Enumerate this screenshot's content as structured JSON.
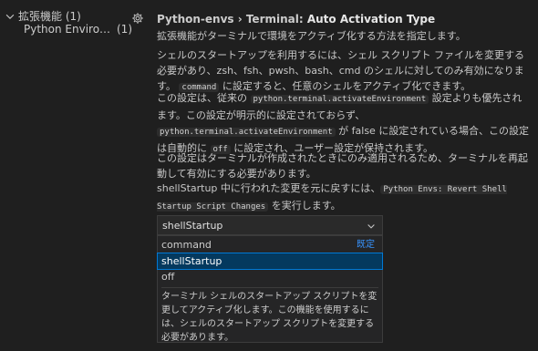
{
  "sidebar": {
    "group_label": "拡張機能 (1)",
    "item_label": "Python Environme...",
    "item_count": "(1)"
  },
  "setting": {
    "category": "Python-envs › Terminal: ",
    "name": "Auto Activation Type",
    "desc1": "拡張機能がターミナルで環境をアクティブ化する方法を指定します。",
    "desc2_a": "シェルのスタートアップを利用するには、シェル スクリプト ファイルを変更する必要があり、zsh、fsh、pwsh、bash、cmd のシェルに対してのみ有効になります。",
    "desc2_code": "command",
    "desc2_b": " に設定すると、任意のシェルをアクティブ化できます。",
    "desc3_a": "この設定は、従来の ",
    "desc3_code1": "python.terminal.activateEnvironment",
    "desc3_b": " 設定よりも優先されます。この設定が明示的に設定されておらず、",
    "desc3_code2": "python.terminal.activateEnvironment",
    "desc3_c": " が false に設定されている場合、この設定は自動的に ",
    "desc3_code3": "off",
    "desc3_d": " に設定され、ユーザー設定が保持されます。",
    "desc4": "この設定はターミナルが作成されたときにのみ適用されるため、ターミナルを再起動して有効にする必要があります。",
    "desc5_a": "shellStartup 中に行われた変更を元に戻すには、",
    "desc5_code": "Python Envs: Revert Shell Startup Script Changes",
    "desc5_b": " を実行します。",
    "select_value": "shellStartup",
    "options": [
      {
        "label": "command",
        "default_badge": "既定"
      },
      {
        "label": "shellStartup"
      },
      {
        "label": "off"
      }
    ],
    "option_description": "ターミナル シェルのスタートアップ スクリプトを変更してアクティブ化します。この機能を使用するには、シェルのスタートアップ スクリプトを変更する必要があります。"
  },
  "colors": {
    "background": "#1f1f1f",
    "selected_option_bg": "#04395e",
    "focus_border": "#0078d4",
    "default_badge": "#3794ff"
  },
  "icons": [
    "chevron-down-icon",
    "gear-icon",
    "select-chevron-icon"
  ]
}
